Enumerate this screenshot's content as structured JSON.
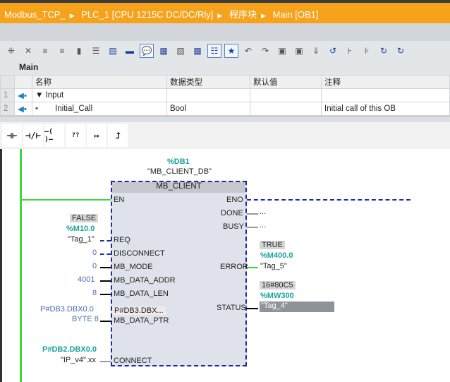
{
  "breadcrumb": [
    "Modbus_TCP_",
    "PLC_1 [CPU 1215C DC/DC/Rly]",
    "程序块",
    "Main [OB1]"
  ],
  "block_header": "Main",
  "interface_table": {
    "columns": [
      "名称",
      "数据类型",
      "默认值",
      "注释"
    ],
    "rows": [
      {
        "num": "1",
        "name": "Input",
        "type": "",
        "default": "",
        "comment": ""
      },
      {
        "num": "2",
        "name": "Initial_Call",
        "type": "Bool",
        "default": "",
        "comment": "Initial call of this OB"
      }
    ]
  },
  "instructions": [
    "⊣⊢",
    "⊣/⊢",
    "–( )–",
    "??",
    "↦",
    "⮥"
  ],
  "fb": {
    "instance_addr": "%DB1",
    "instance_name": "\"MB_CLIENT_DB\"",
    "title": "MB_CLIENT",
    "inputs": {
      "en": "EN",
      "req": "REQ",
      "disconnect": "DISCONNECT",
      "mode": "MB_MODE",
      "addr": "MB_DATA_ADDR",
      "len": "MB_DATA_LEN",
      "ptr": "MB_DATA_PTR",
      "ptr_val": "P#DB3.DBX...",
      "connect": "CONNECT"
    },
    "outputs": {
      "eno": "ENO",
      "done": "DONE",
      "busy": "BUSY",
      "error": "ERROR",
      "status": "STATUS"
    },
    "req_value": "FALSE",
    "req_addr": "%M10.0",
    "req_tag": "\"Tag_1\"",
    "disconnect_val": "0",
    "mode_val": "0",
    "addr_val": "4001",
    "len_val": "8",
    "ptr_line1": "P#DB3.DBX0.0",
    "ptr_line2": "BYTE 8",
    "connect_addr": "P#DB2.DBX0.0",
    "connect_tag": "\"IP_v4\".xx",
    "done_val": "...",
    "busy_val": "...",
    "error_value": "TRUE",
    "error_addr": "%M400.0",
    "error_tag": "\"Tag_5\"",
    "status_value": "16#80C5",
    "status_addr": "%MW300",
    "status_tag": "\"Tag_4\""
  },
  "colors": {
    "accent": "#f7a21b",
    "rail": "#3ed83e",
    "block_border": "#1c2aa8"
  }
}
